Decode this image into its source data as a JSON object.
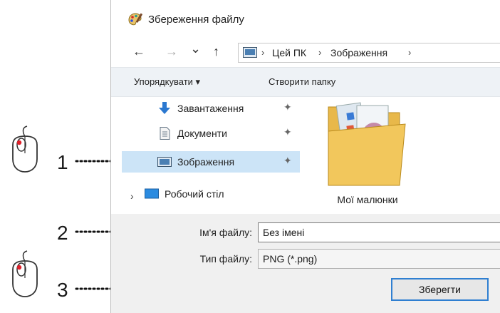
{
  "dialog": {
    "title": "Збереження файлу",
    "nav": {
      "back": "←",
      "forward": "→",
      "recent": "⌄",
      "up": "↑"
    },
    "breadcrumb": [
      "Цей ПК",
      "Зображення"
    ],
    "separator": "›",
    "toolbar": {
      "organize": "Упорядкувати ▾",
      "new_folder": "Створити папку"
    },
    "sidebar": [
      {
        "label": "Завантаження",
        "icon": "download-icon",
        "pinned": true
      },
      {
        "label": "Документи",
        "icon": "documents-icon",
        "pinned": true
      },
      {
        "label": "Зображення",
        "icon": "pictures-icon",
        "pinned": true,
        "selected": true
      },
      {
        "label": "Робочий стіл",
        "icon": "desktop-icon",
        "pinned": false
      }
    ],
    "expander": "›",
    "pin_glyph": "✦",
    "folder": {
      "label": "Мої малюнки"
    },
    "filename": {
      "label": "Ім'я файлу:",
      "value": "Без імені"
    },
    "filetype": {
      "label": "Тип файлу:",
      "value": "PNG (*.png)"
    },
    "save_button": "Зберегти"
  },
  "annotations": [
    {
      "number": "1",
      "mouse": true
    },
    {
      "number": "2",
      "mouse": false
    },
    {
      "number": "3",
      "mouse": true
    }
  ],
  "colors": {
    "selection": "#cce4f7",
    "toolbar_bg": "#eef2f6",
    "button_border": "#2f7fd1",
    "mouse_button": "#e0202a"
  }
}
